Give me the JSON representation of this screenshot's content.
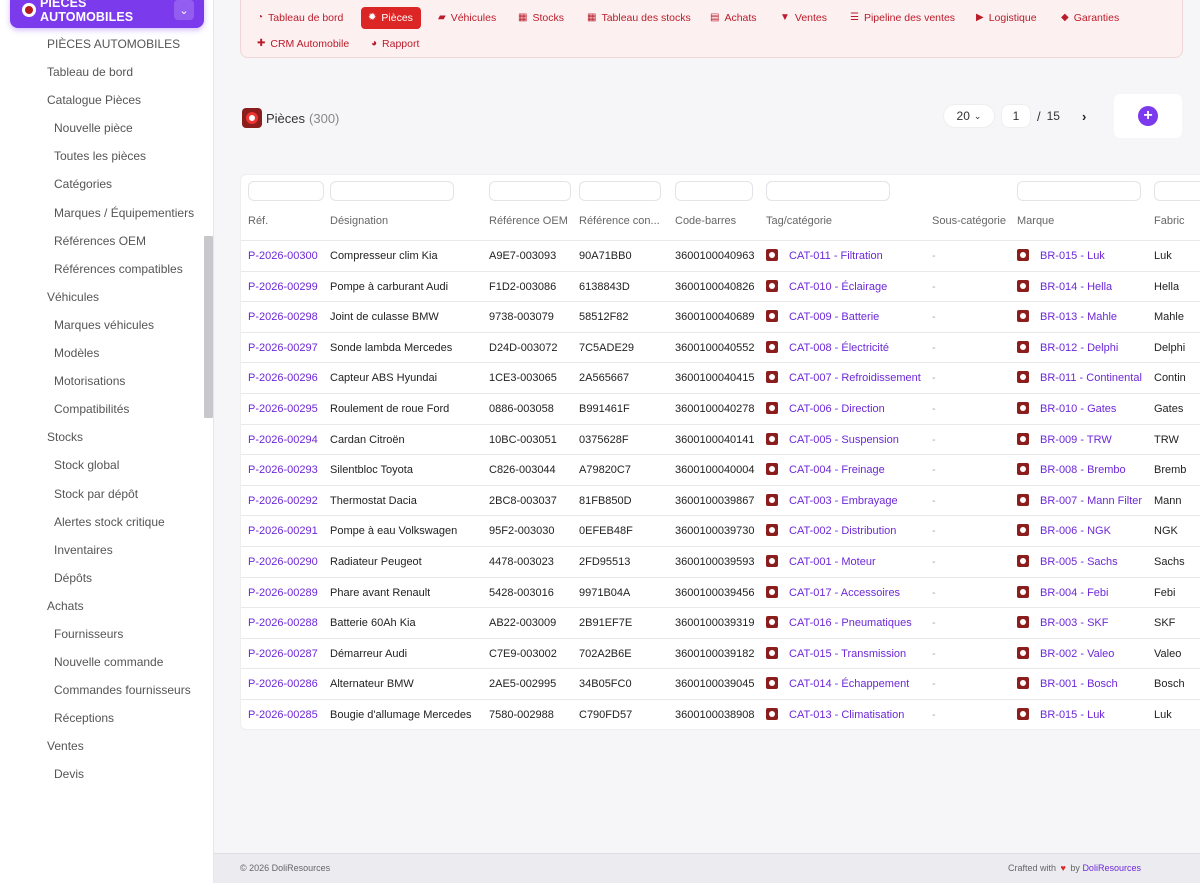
{
  "app_switcher": {
    "title": "PIÈCES AUTOMOBILES"
  },
  "sidebar": {
    "items": [
      {
        "label": "PIÈCES AUTOMOBILES",
        "level": 0
      },
      {
        "label": "Tableau de bord",
        "level": 0
      },
      {
        "label": "Catalogue Pièces",
        "level": 0
      },
      {
        "label": "Nouvelle pièce",
        "level": 1
      },
      {
        "label": "Toutes les pièces",
        "level": 1
      },
      {
        "label": "Catégories",
        "level": 1
      },
      {
        "label": "Marques / Équipementiers",
        "level": 1
      },
      {
        "label": "Références OEM",
        "level": 1
      },
      {
        "label": "Références compatibles",
        "level": 1
      },
      {
        "label": "Véhicules",
        "level": 0
      },
      {
        "label": "Marques véhicules",
        "level": 1
      },
      {
        "label": "Modèles",
        "level": 1
      },
      {
        "label": "Motorisations",
        "level": 1
      },
      {
        "label": "Compatibilités",
        "level": 1
      },
      {
        "label": "Stocks",
        "level": 0
      },
      {
        "label": "Stock global",
        "level": 1
      },
      {
        "label": "Stock par dépôt",
        "level": 1
      },
      {
        "label": "Alertes stock critique",
        "level": 1
      },
      {
        "label": "Inventaires",
        "level": 1
      },
      {
        "label": "Dépôts",
        "level": 1
      },
      {
        "label": "Achats",
        "level": 0
      },
      {
        "label": "Fournisseurs",
        "level": 1
      },
      {
        "label": "Nouvelle commande",
        "level": 1
      },
      {
        "label": "Commandes fournisseurs",
        "level": 1
      },
      {
        "label": "Réceptions",
        "level": 1
      },
      {
        "label": "Ventes",
        "level": 0
      },
      {
        "label": "Devis",
        "level": 1
      }
    ]
  },
  "topnav": {
    "tabs": [
      {
        "label": "Tableau de bord",
        "icon": "gauge-icon",
        "glyph": "◔",
        "active": false
      },
      {
        "label": "Pièces",
        "icon": "gear-icon",
        "glyph": "✹",
        "active": true
      },
      {
        "label": "Véhicules",
        "icon": "car-icon",
        "glyph": "▰",
        "active": false
      },
      {
        "label": "Stocks",
        "icon": "boxes-icon",
        "glyph": "▦",
        "active": false
      },
      {
        "label": "Tableau des stocks",
        "icon": "grid-icon",
        "glyph": "▦",
        "active": false
      },
      {
        "label": "Achats",
        "icon": "invoice-icon",
        "glyph": "▤",
        "active": false
      },
      {
        "label": "Ventes",
        "icon": "cart-icon",
        "glyph": "▼",
        "active": false
      },
      {
        "label": "Pipeline des ventes",
        "icon": "list-icon",
        "glyph": "☰",
        "active": false
      },
      {
        "label": "Logistique",
        "icon": "truck-icon",
        "glyph": "▶",
        "active": false
      },
      {
        "label": "Garanties",
        "icon": "shield-icon",
        "glyph": "◆",
        "active": false
      },
      {
        "label": "CRM Automobile",
        "icon": "user-plus-icon",
        "glyph": "✚",
        "active": false
      },
      {
        "label": "Rapport",
        "icon": "pie-chart-icon",
        "glyph": "◕",
        "active": false
      }
    ]
  },
  "page": {
    "title": "Pièces",
    "count": "(300)",
    "per_page": "20",
    "current_page": "1",
    "page_separator": "/",
    "total_pages": "15"
  },
  "table": {
    "columns": [
      "Réf.",
      "Désignation",
      "Référence OEM",
      "Référence con...",
      "Code-barres",
      "Tag/catégorie",
      "Sous-catégorie",
      "Marque",
      "Fabric"
    ],
    "rows": [
      {
        "ref": "P-2026-00300",
        "designation": "Compresseur clim Kia",
        "oem": "A9E7-003093",
        "compat": "90A71BB0",
        "barcode": "3600100040963",
        "category": "CAT-011 - Filtration",
        "subcategory": "-",
        "brand": "BR-015 - Luk",
        "maker": "Luk"
      },
      {
        "ref": "P-2026-00299",
        "designation": "Pompe à carburant Audi",
        "oem": "F1D2-003086",
        "compat": "6138843D",
        "barcode": "3600100040826",
        "category": "CAT-010 - Éclairage",
        "subcategory": "-",
        "brand": "BR-014 - Hella",
        "maker": "Hella"
      },
      {
        "ref": "P-2026-00298",
        "designation": "Joint de culasse BMW",
        "oem": "9738-003079",
        "compat": "58512F82",
        "barcode": "3600100040689",
        "category": "CAT-009 - Batterie",
        "subcategory": "-",
        "brand": "BR-013 - Mahle",
        "maker": "Mahle"
      },
      {
        "ref": "P-2026-00297",
        "designation": "Sonde lambda Mercedes",
        "oem": "D24D-003072",
        "compat": "7C5ADE29",
        "barcode": "3600100040552",
        "category": "CAT-008 - Électricité",
        "subcategory": "-",
        "brand": "BR-012 - Delphi",
        "maker": "Delphi"
      },
      {
        "ref": "P-2026-00296",
        "designation": "Capteur ABS Hyundai",
        "oem": "1CE3-003065",
        "compat": "2A565667",
        "barcode": "3600100040415",
        "category": "CAT-007 - Refroidissement",
        "subcategory": "-",
        "brand": "BR-011 - Continental",
        "maker": "Contin"
      },
      {
        "ref": "P-2026-00295",
        "designation": "Roulement de roue Ford",
        "oem": "0886-003058",
        "compat": "B991461F",
        "barcode": "3600100040278",
        "category": "CAT-006 - Direction",
        "subcategory": "-",
        "brand": "BR-010 - Gates",
        "maker": "Gates"
      },
      {
        "ref": "P-2026-00294",
        "designation": "Cardan Citroën",
        "oem": "10BC-003051",
        "compat": "0375628F",
        "barcode": "3600100040141",
        "category": "CAT-005 - Suspension",
        "subcategory": "-",
        "brand": "BR-009 - TRW",
        "maker": "TRW"
      },
      {
        "ref": "P-2026-00293",
        "designation": "Silentbloc Toyota",
        "oem": "C826-003044",
        "compat": "A79820C7",
        "barcode": "3600100040004",
        "category": "CAT-004 - Freinage",
        "subcategory": "-",
        "brand": "BR-008 - Brembo",
        "maker": "Bremb"
      },
      {
        "ref": "P-2026-00292",
        "designation": "Thermostat Dacia",
        "oem": "2BC8-003037",
        "compat": "81FB850D",
        "barcode": "3600100039867",
        "category": "CAT-003 - Embrayage",
        "subcategory": "-",
        "brand": "BR-007 - Mann Filter",
        "maker": "Mann"
      },
      {
        "ref": "P-2026-00291",
        "designation": "Pompe à eau Volkswagen",
        "oem": "95F2-003030",
        "compat": "0EFEB48F",
        "barcode": "3600100039730",
        "category": "CAT-002 - Distribution",
        "subcategory": "-",
        "brand": "BR-006 - NGK",
        "maker": "NGK"
      },
      {
        "ref": "P-2026-00290",
        "designation": "Radiateur Peugeot",
        "oem": "4478-003023",
        "compat": "2FD95513",
        "barcode": "3600100039593",
        "category": "CAT-001 - Moteur",
        "subcategory": "-",
        "brand": "BR-005 - Sachs",
        "maker": "Sachs"
      },
      {
        "ref": "P-2026-00289",
        "designation": "Phare avant Renault",
        "oem": "5428-003016",
        "compat": "9971B04A",
        "barcode": "3600100039456",
        "category": "CAT-017 - Accessoires",
        "subcategory": "-",
        "brand": "BR-004 - Febi",
        "maker": "Febi"
      },
      {
        "ref": "P-2026-00288",
        "designation": "Batterie 60Ah Kia",
        "oem": "AB22-003009",
        "compat": "2B91EF7E",
        "barcode": "3600100039319",
        "category": "CAT-016 - Pneumatiques",
        "subcategory": "-",
        "brand": "BR-003 - SKF",
        "maker": "SKF"
      },
      {
        "ref": "P-2026-00287",
        "designation": "Démarreur Audi",
        "oem": "C7E9-003002",
        "compat": "702A2B6E",
        "barcode": "3600100039182",
        "category": "CAT-015 - Transmission",
        "subcategory": "-",
        "brand": "BR-002 - Valeo",
        "maker": "Valeo"
      },
      {
        "ref": "P-2026-00286",
        "designation": "Alternateur BMW",
        "oem": "2AE5-002995",
        "compat": "34B05FC0",
        "barcode": "3600100039045",
        "category": "CAT-014 - Échappement",
        "subcategory": "-",
        "brand": "BR-001 - Bosch",
        "maker": "Bosch"
      },
      {
        "ref": "P-2026-00285",
        "designation": "Bougie d'allumage Mercedes",
        "oem": "7580-002988",
        "compat": "C790FD57",
        "barcode": "3600100038908",
        "category": "CAT-013 - Climatisation",
        "subcategory": "-",
        "brand": "BR-015 - Luk",
        "maker": "Luk"
      }
    ]
  },
  "footer": {
    "copyright": "© 2026 DoliResources",
    "crafted_prefix": "Crafted with",
    "crafted_by": "by",
    "crafted_brand": "DoliResources"
  },
  "colors": {
    "accent": "#7c3aed",
    "active_tab": "#dc2626",
    "link": "#6d28d9"
  }
}
